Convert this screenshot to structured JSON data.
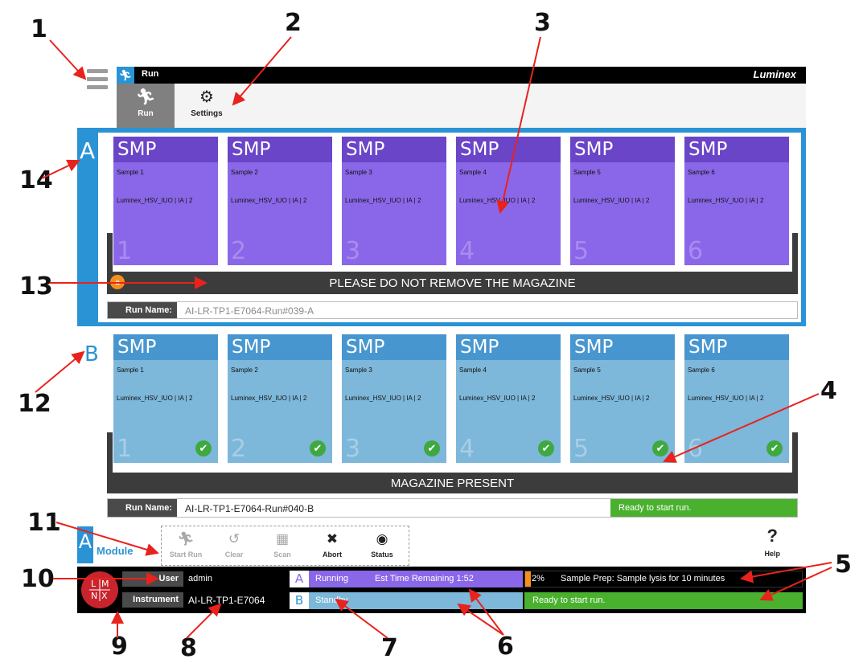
{
  "callouts": [
    "1",
    "2",
    "3",
    "4",
    "5",
    "6",
    "7",
    "8",
    "9",
    "10",
    "11",
    "12",
    "13",
    "14"
  ],
  "titlebar": {
    "title": "Run",
    "brand": "Luminex"
  },
  "tabs": [
    {
      "label": "Run"
    },
    {
      "label": "Settings"
    }
  ],
  "module_a": {
    "letter": "A",
    "cartridges": [
      {
        "type": "SMP",
        "sample": "Sample 1",
        "assay": "Luminex_HSV_IUO | IA | 2",
        "position": "1"
      },
      {
        "type": "SMP",
        "sample": "Sample 2",
        "assay": "Luminex_HSV_IUO | IA | 2",
        "position": "2"
      },
      {
        "type": "SMP",
        "sample": "Sample 3",
        "assay": "Luminex_HSV_IUO | IA | 2",
        "position": "3"
      },
      {
        "type": "SMP",
        "sample": "Sample 4",
        "assay": "Luminex_HSV_IUO | IA | 2",
        "position": "4"
      },
      {
        "type": "SMP",
        "sample": "Sample 5",
        "assay": "Luminex_HSV_IUO | IA | 2",
        "position": "5"
      },
      {
        "type": "SMP",
        "sample": "Sample 6",
        "assay": "Luminex_HSV_IUO | IA | 2",
        "position": "6"
      }
    ],
    "magazine_message": "PLEASE DO NOT REMOVE THE MAGAZINE",
    "run_name_label": "Run Name:",
    "run_name": "AI-LR-TP1-E7064-Run#039-A"
  },
  "module_b": {
    "letter": "B",
    "cartridges": [
      {
        "type": "SMP",
        "sample": "Sample 1",
        "assay": "Luminex_HSV_IUO | IA | 2",
        "position": "1"
      },
      {
        "type": "SMP",
        "sample": "Sample 2",
        "assay": "Luminex_HSV_IUO | IA | 2",
        "position": "2"
      },
      {
        "type": "SMP",
        "sample": "Sample 3",
        "assay": "Luminex_HSV_IUO | IA | 2",
        "position": "3"
      },
      {
        "type": "SMP",
        "sample": "Sample 4",
        "assay": "Luminex_HSV_IUO | IA | 2",
        "position": "4"
      },
      {
        "type": "SMP",
        "sample": "Sample 5",
        "assay": "Luminex_HSV_IUO | IA | 2",
        "position": "5"
      },
      {
        "type": "SMP",
        "sample": "Sample 6",
        "assay": "Luminex_HSV_IUO | IA | 2",
        "position": "6"
      }
    ],
    "magazine_message": "MAGAZINE PRESENT",
    "run_name_label": "Run Name:",
    "run_name": "AI-LR-TP1-E7064-Run#040-B",
    "run_status": "Ready to start run."
  },
  "module_bar": {
    "letter": "A",
    "label": "Module",
    "actions": [
      {
        "label": "Start Run",
        "icon": "run-icon",
        "enabled": false
      },
      {
        "label": "Clear",
        "icon": "undo-icon",
        "enabled": false
      },
      {
        "label": "Scan",
        "icon": "barcode-icon",
        "enabled": false
      },
      {
        "label": "Abort",
        "icon": "abort-icon",
        "enabled": true
      },
      {
        "label": "Status",
        "icon": "eye-icon",
        "enabled": true
      }
    ],
    "help_label": "Help"
  },
  "status_bar": {
    "logo_letters": [
      "L",
      "M",
      "N",
      "X"
    ],
    "user_label": "User",
    "user": "admin",
    "instrument_label": "Instrument",
    "instrument": "AI-LR-TP1-E7064",
    "module_a_letter": "A",
    "module_a_status": "Running",
    "module_a_estimate": "Est Time Remaining 1:52",
    "module_b_letter": "B",
    "module_b_status": "Standby",
    "progress_percent": "2%",
    "progress_value": 0.02,
    "progress_step": "Sample Prep: Sample lysis for 10 minutes",
    "module_b_ready": "Ready to start run."
  },
  "colors": {
    "accent_blue": "#2a93d5",
    "module_a_purple": "#8a67e8",
    "module_b_blue": "#7db7da",
    "ready_green": "#49b12e",
    "progress_orange": "#f48f1d",
    "arrow_red": "#e8221c"
  }
}
